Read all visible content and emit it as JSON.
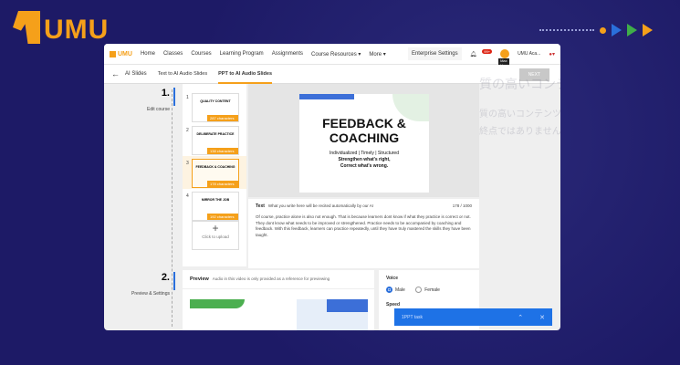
{
  "brand": {
    "name": "UMU"
  },
  "nav": {
    "logo": "UMU",
    "items": [
      "Home",
      "Classes",
      "Courses",
      "Learning Program",
      "Assignments",
      "Course Resources ▾",
      "More ▾"
    ],
    "enterprise": "Enterprise Settings",
    "badge": "99+",
    "user": "UMU Aca...",
    "tooltip": "Max LI"
  },
  "subnav": {
    "back": "AI Slides",
    "tabs": [
      "Text to AI Audio Slides",
      "PPT to AI Audio Slides"
    ],
    "next": "NEXT"
  },
  "steps": [
    {
      "num": "1.",
      "label": "Edit course"
    },
    {
      "num": "2.",
      "label": "Preview & Settings"
    }
  ],
  "thumbnails": [
    {
      "num": "1",
      "title": "QUALITY CONTENT",
      "chars": "287 characters"
    },
    {
      "num": "2",
      "title": "DELIBERATE PRACTICE",
      "chars": "138 characters"
    },
    {
      "num": "3",
      "title": "FEEDBACK & COACHING",
      "chars": "178 characters"
    },
    {
      "num": "4",
      "title": "MIRROR THE JOB",
      "chars": "192 characters"
    }
  ],
  "upload": "Click to upload",
  "slide": {
    "title": "FEEDBACK & COACHING",
    "line1": "Individualized | Timely | Structured",
    "line2": "Strengthen what's right,",
    "line3": "Correct what's wrong."
  },
  "text_panel": {
    "label": "Text",
    "hint": "What you write here will be recited automatically by our AI",
    "count": "178 / 1000",
    "body": "Of course, practice alone is also not enough. That is because learners dont know if what they practice is correct or not. They dont know what needs to be improved or strengthened. Practice needs to be accompanied by coaching and feedback. With this feedback, learners can practice repeatedly, until they have truly mastered the skills they have been taught."
  },
  "background_text": [
    "質の高いコンテンツと授業",
    "質の高いコンテンツは出発点であって",
    "終点ではありません"
  ],
  "preview": {
    "label": "Preview",
    "hint": "Audio in this video is only provided as a reference for previewing"
  },
  "voice": {
    "label": "Voice",
    "options": [
      "Male",
      "Female"
    ],
    "selected": "Male",
    "speed_label": "Speed"
  },
  "task": {
    "label": "1PPT task"
  }
}
